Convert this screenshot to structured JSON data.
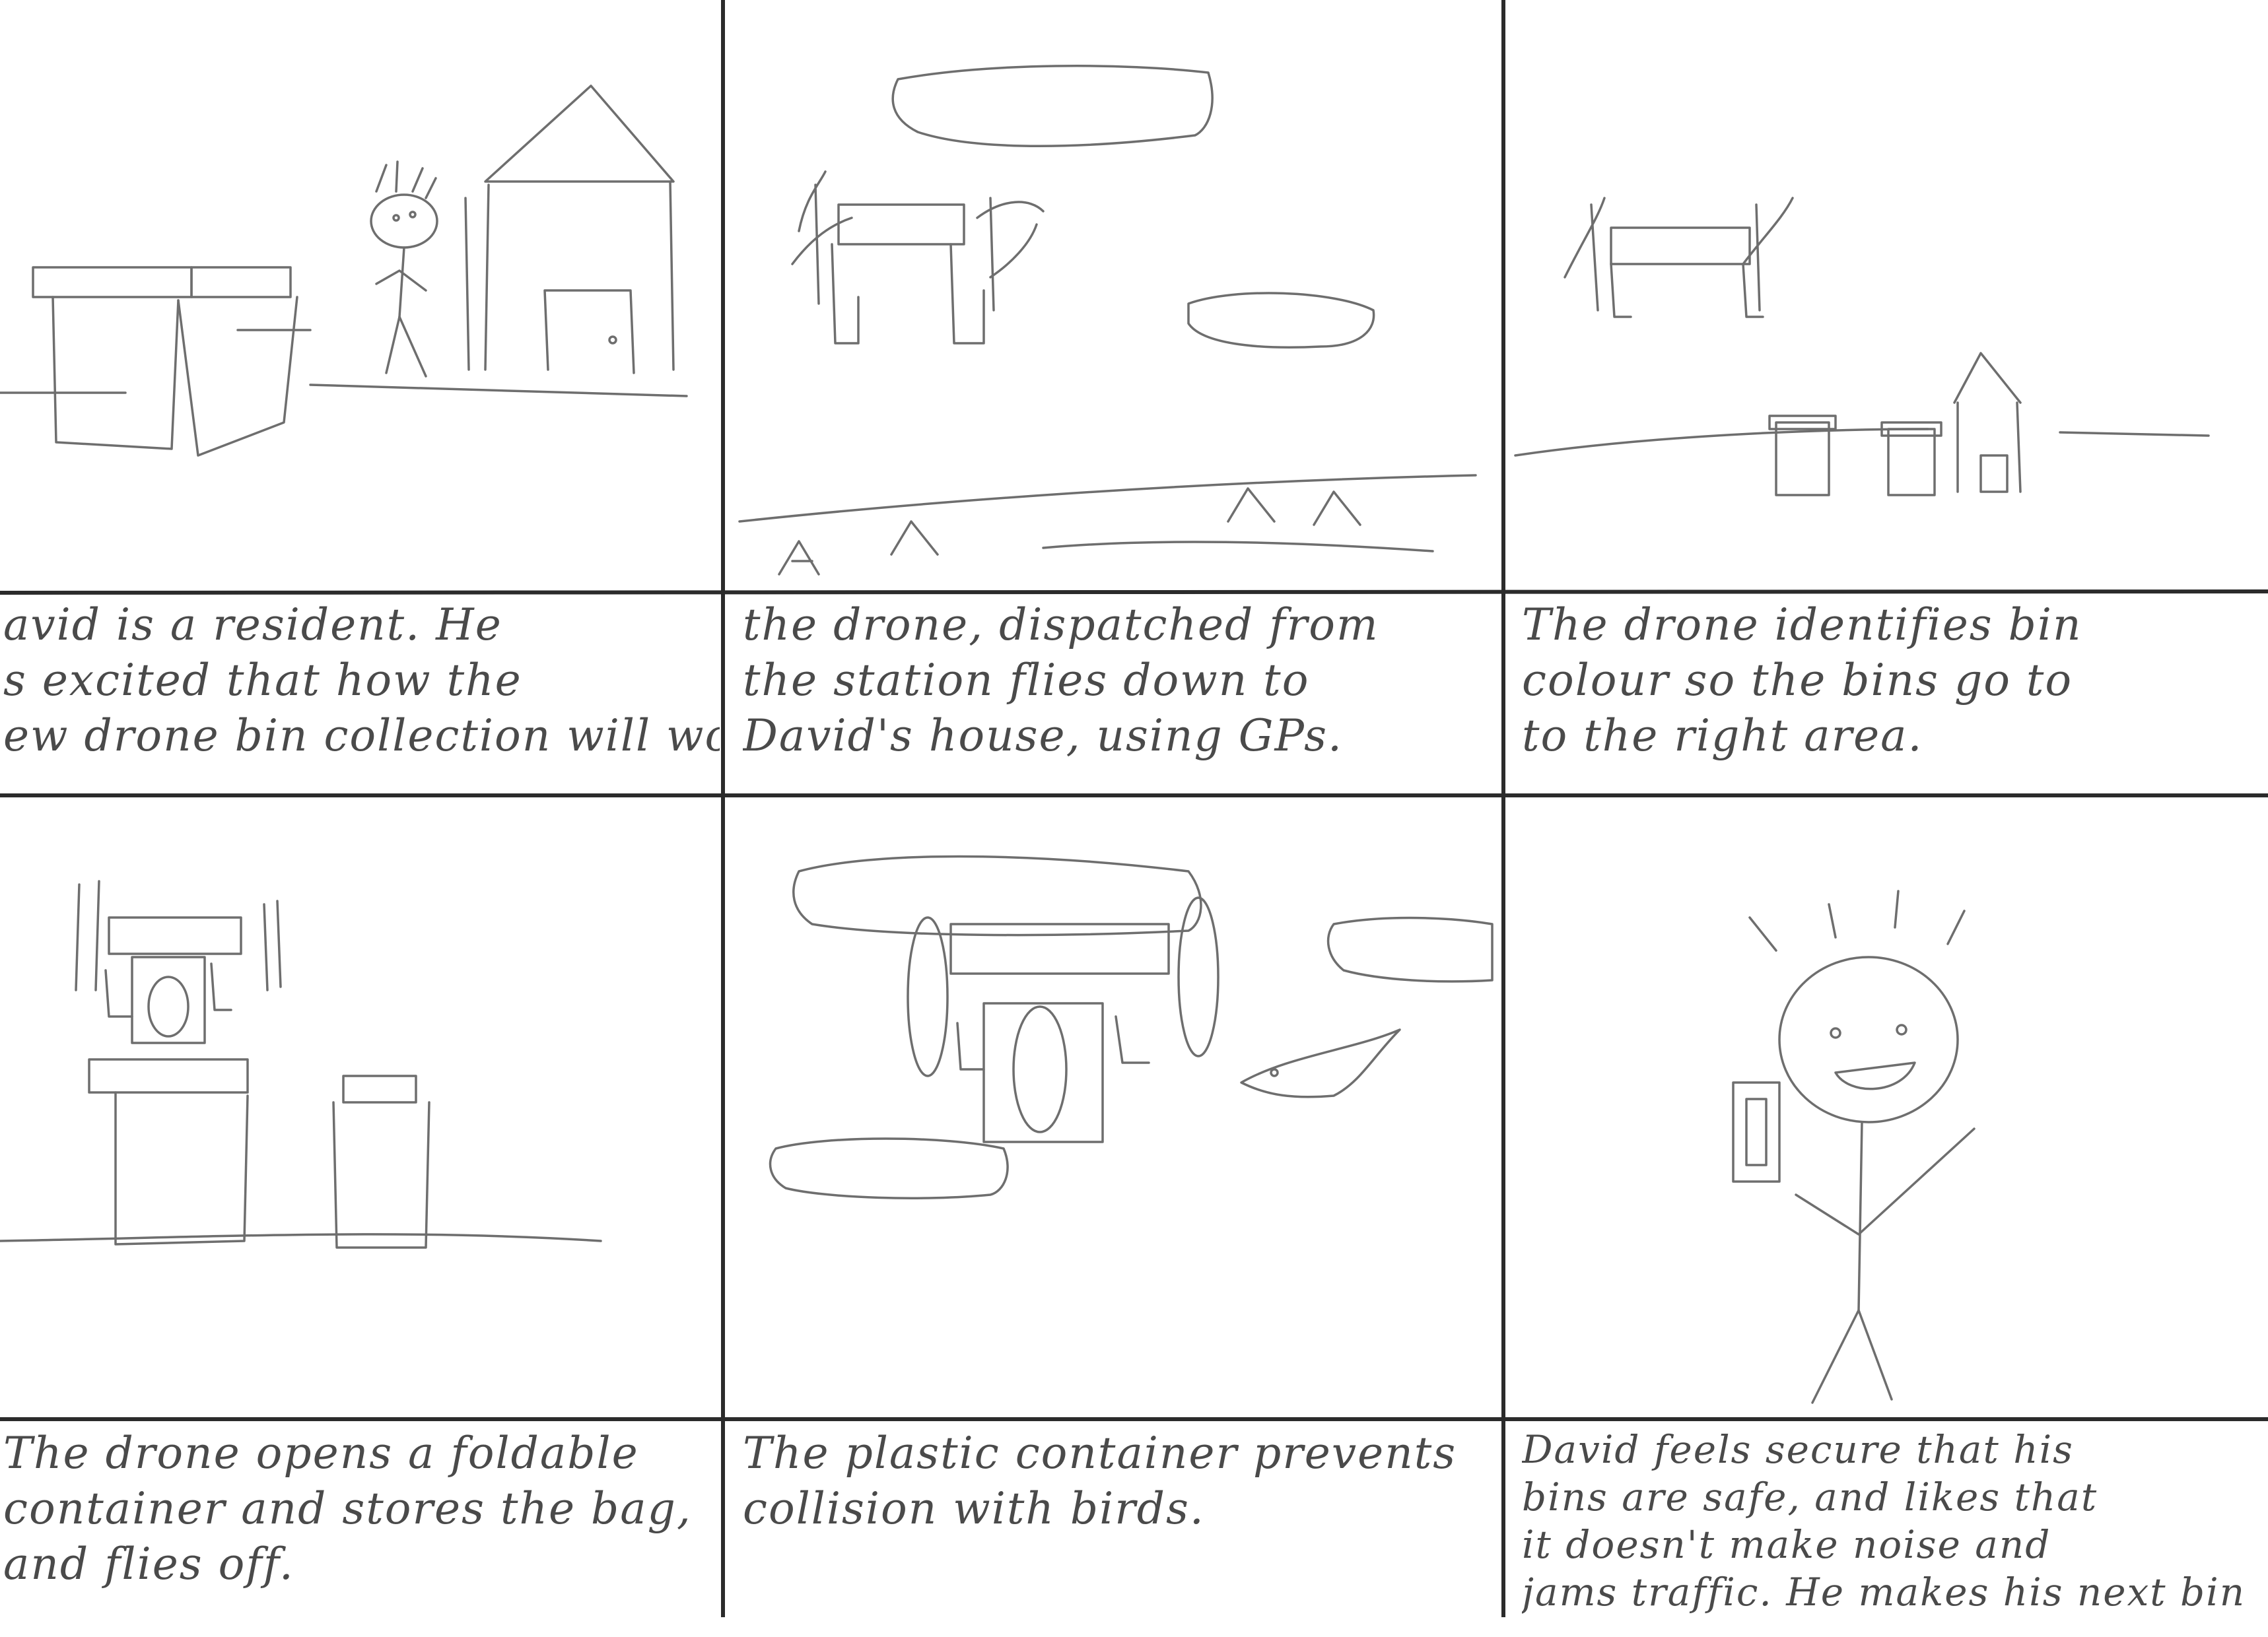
{
  "panels": [
    {
      "lines": [
        "avid is a resident. He",
        "s excited that how the",
        "ew drone bin collection will work."
      ]
    },
    {
      "lines": [
        "the drone, dispatched from",
        "the station flies down to",
        "David's house, using GPs."
      ]
    },
    {
      "lines": [
        "The drone identifies bin",
        "colour so the bins go to",
        "to the right area."
      ]
    },
    {
      "lines": [
        "The drone opens a foldable",
        "container and stores the bag,",
        "and flies off."
      ]
    },
    {
      "lines": [
        "The plastic container prevents",
        "collision with birds."
      ]
    },
    {
      "lines": [
        "David feels secure that his",
        "bins are safe, and likes that",
        "it doesn't make noise and",
        "jams traffic. He makes his next bin"
      ]
    }
  ]
}
